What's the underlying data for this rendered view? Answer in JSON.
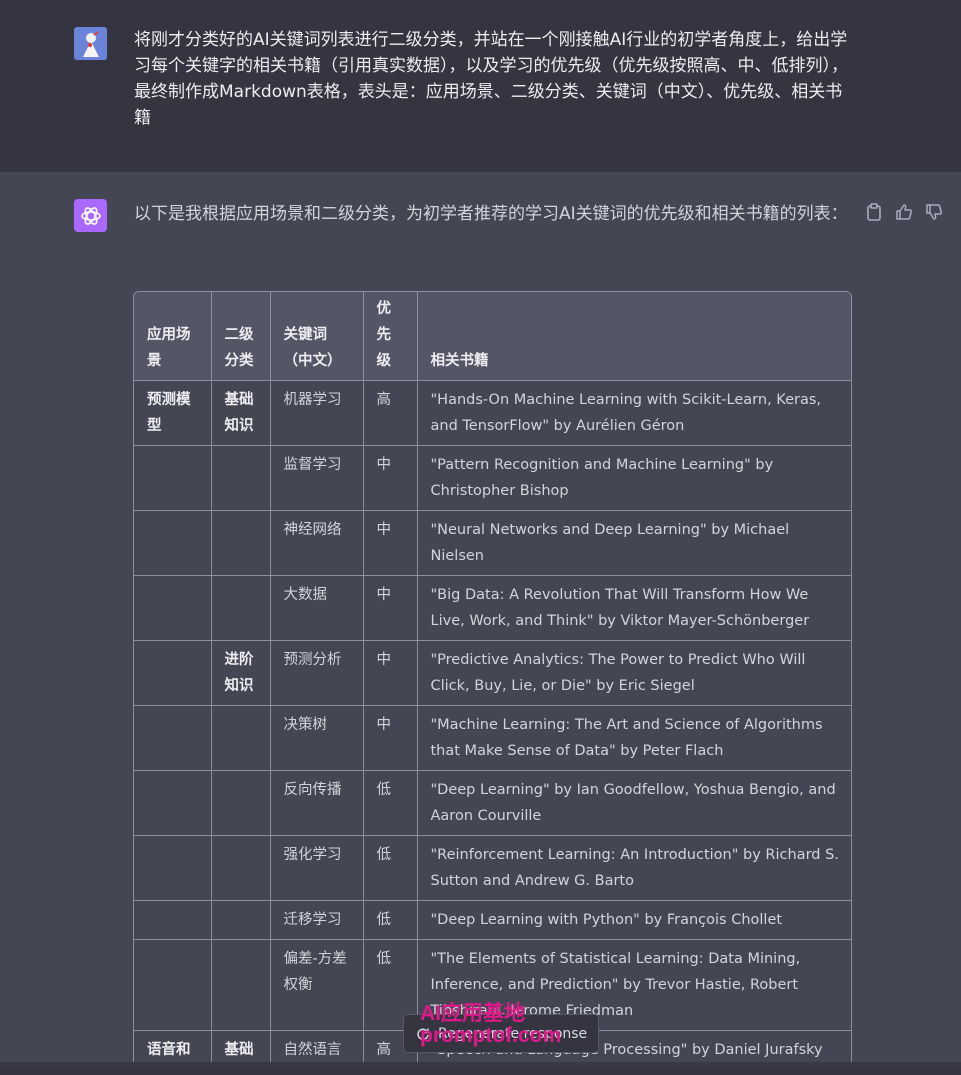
{
  "user_message": {
    "text": "将刚才分类好的AI关键词列表进行二级分类，并站在一个刚接触AI行业的初学者角度上，给出学习每个关键字的相关书籍（引用真实数据），以及学习的优先级（优先级按照高、中、低排列），最终制作成Markdown表格，表头是：应用场景、二级分类、关键词（中文）、优先级、相关书籍"
  },
  "assistant_message": {
    "intro": "以下是我根据应用场景和二级分类，为初学者推荐的学习AI关键词的优先级和相关书籍的列表：",
    "action_icons": [
      "copy-icon",
      "thumbs-up-icon",
      "thumbs-down-icon"
    ]
  },
  "table": {
    "headers": [
      "应用场景",
      "二级分类",
      "关键词（中文）",
      "优先级",
      "相关书籍"
    ],
    "rows": [
      [
        "预测模型",
        "基础知识",
        "机器学习",
        "高",
        "\"Hands-On Machine Learning with Scikit-Learn, Keras, and TensorFlow\" by Aurélien Géron"
      ],
      [
        "",
        "",
        "监督学习",
        "中",
        "\"Pattern Recognition and Machine Learning\" by Christopher Bishop"
      ],
      [
        "",
        "",
        "神经网络",
        "中",
        "\"Neural Networks and Deep Learning\" by Michael Nielsen"
      ],
      [
        "",
        "",
        "大数据",
        "中",
        "\"Big Data: A Revolution That Will Transform How We Live, Work, and Think\" by Viktor Mayer-Schönberger"
      ],
      [
        "",
        "进阶知识",
        "预测分析",
        "中",
        "\"Predictive Analytics: The Power to Predict Who Will Click, Buy, Lie, or Die\" by Eric Siegel"
      ],
      [
        "",
        "",
        "决策树",
        "中",
        "\"Machine Learning: The Art and Science of Algorithms that Make Sense of Data\" by Peter Flach"
      ],
      [
        "",
        "",
        "反向传播",
        "低",
        "\"Deep Learning\" by Ian Goodfellow, Yoshua Bengio, and Aaron Courville"
      ],
      [
        "",
        "",
        "强化学习",
        "低",
        "\"Reinforcement Learning: An Introduction\" by Richard S. Sutton and Andrew G. Barto"
      ],
      [
        "",
        "",
        "迁移学习",
        "低",
        "\"Deep Learning with Python\" by François Chollet"
      ],
      [
        "",
        "",
        "偏差-方差权衡",
        "低",
        "\"The Elements of Statistical Learning: Data Mining, Inference, and Prediction\" by Trevor Hastie, Robert Tibshirani, Jerome Friedman"
      ],
      [
        "语音和文本处理",
        "基础知识",
        "自然语言处理",
        "高",
        "\"Speech and Language Processing\" by Daniel Jurafsky and"
      ]
    ]
  },
  "regenerate_button": {
    "label": "Regenerate response",
    "icon": "refresh-icon"
  },
  "watermark": {
    "line1": "AI应用基地",
    "line2": "promptof.com"
  },
  "colors": {
    "user_bg": "#343541",
    "assistant_bg": "#444654",
    "assistant_avatar": "#ab68ff",
    "table_header_bg": "#545565",
    "watermark": "#e0198a"
  }
}
